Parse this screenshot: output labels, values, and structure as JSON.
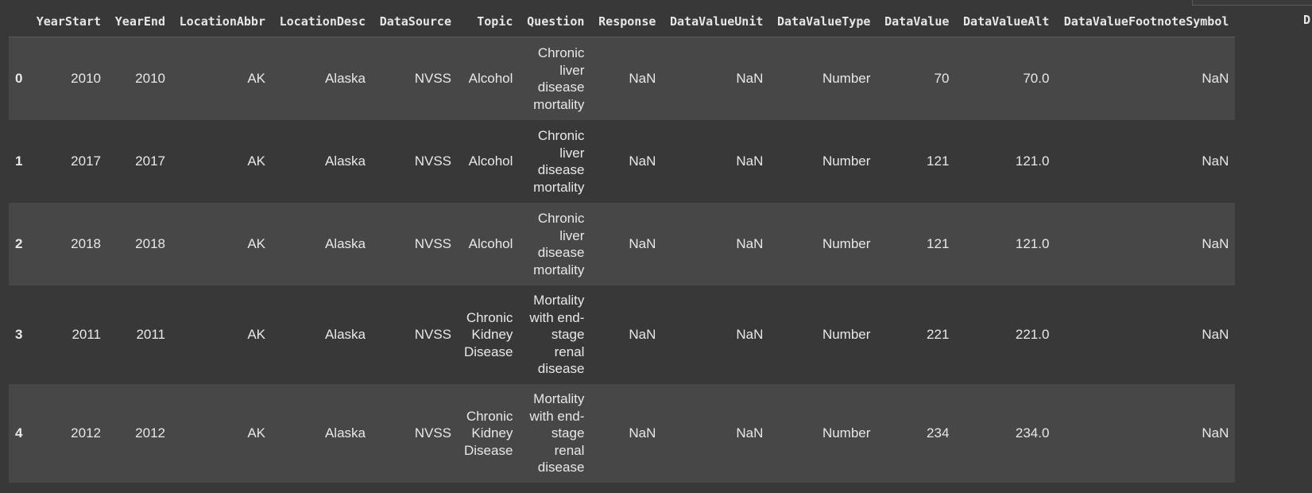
{
  "table": {
    "columns": [
      "",
      "YearStart",
      "YearEnd",
      "LocationAbbr",
      "LocationDesc",
      "DataSource",
      "Topic",
      "Question",
      "Response",
      "DataValueUnit",
      "DataValueType",
      "DataValue",
      "DataValueAlt",
      "DataValueFootnoteSymbol"
    ],
    "cut_column_head": "D",
    "rows": [
      {
        "index": "0",
        "YearStart": "2010",
        "YearEnd": "2010",
        "LocationAbbr": "AK",
        "LocationDesc": "Alaska",
        "DataSource": "NVSS",
        "Topic": "Alcohol",
        "Question": "Chronic liver disease mortality",
        "Response": "NaN",
        "DataValueUnit": "NaN",
        "DataValueType": "Number",
        "DataValue": "70",
        "DataValueAlt": "70.0",
        "DataValueFootnoteSymbol": "NaN"
      },
      {
        "index": "1",
        "YearStart": "2017",
        "YearEnd": "2017",
        "LocationAbbr": "AK",
        "LocationDesc": "Alaska",
        "DataSource": "NVSS",
        "Topic": "Alcohol",
        "Question": "Chronic liver disease mortality",
        "Response": "NaN",
        "DataValueUnit": "NaN",
        "DataValueType": "Number",
        "DataValue": "121",
        "DataValueAlt": "121.0",
        "DataValueFootnoteSymbol": "NaN"
      },
      {
        "index": "2",
        "YearStart": "2018",
        "YearEnd": "2018",
        "LocationAbbr": "AK",
        "LocationDesc": "Alaska",
        "DataSource": "NVSS",
        "Topic": "Alcohol",
        "Question": "Chronic liver disease mortality",
        "Response": "NaN",
        "DataValueUnit": "NaN",
        "DataValueType": "Number",
        "DataValue": "121",
        "DataValueAlt": "121.0",
        "DataValueFootnoteSymbol": "NaN"
      },
      {
        "index": "3",
        "YearStart": "2011",
        "YearEnd": "2011",
        "LocationAbbr": "AK",
        "LocationDesc": "Alaska",
        "DataSource": "NVSS",
        "Topic": "Chronic Kidney Disease",
        "Question": "Mortality with end-stage renal disease",
        "Response": "NaN",
        "DataValueUnit": "NaN",
        "DataValueType": "Number",
        "DataValue": "221",
        "DataValueAlt": "221.0",
        "DataValueFootnoteSymbol": "NaN"
      },
      {
        "index": "4",
        "YearStart": "2012",
        "YearEnd": "2012",
        "LocationAbbr": "AK",
        "LocationDesc": "Alaska",
        "DataSource": "NVSS",
        "Topic": "Chronic Kidney Disease",
        "Question": "Mortality with end-stage renal disease",
        "Response": "NaN",
        "DataValueUnit": "NaN",
        "DataValueType": "Number",
        "DataValue": "234",
        "DataValueAlt": "234.0",
        "DataValueFootnoteSymbol": "NaN"
      }
    ]
  }
}
